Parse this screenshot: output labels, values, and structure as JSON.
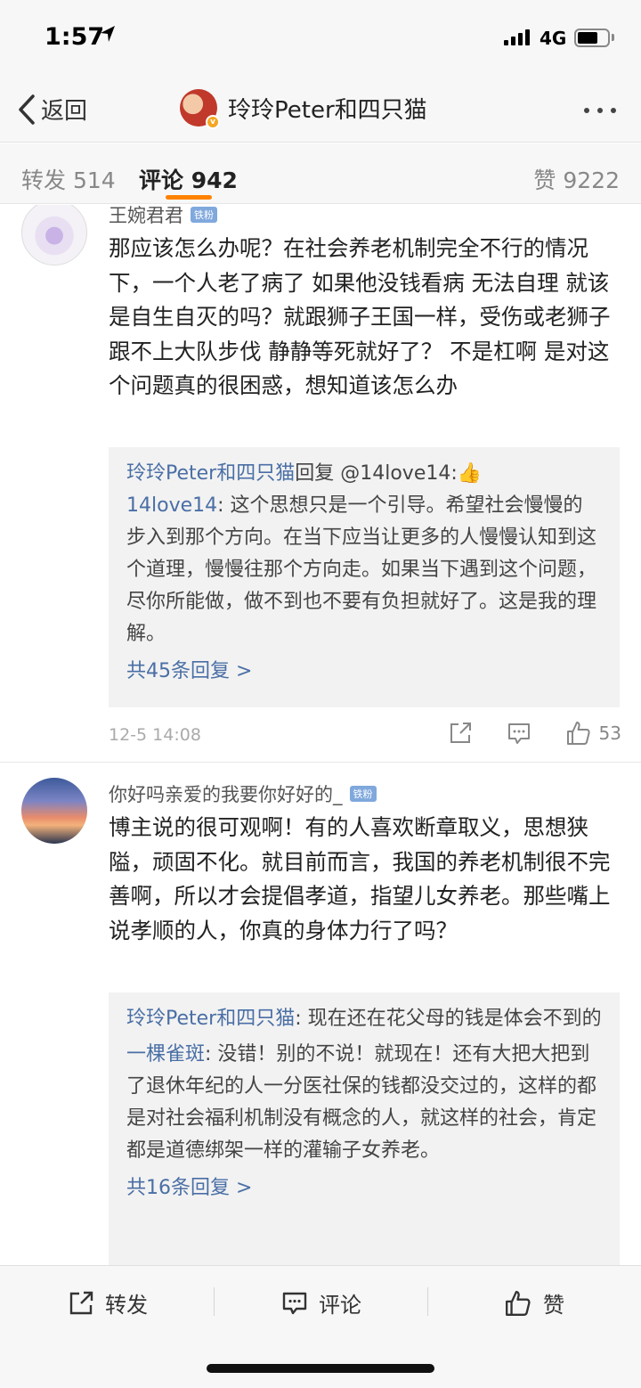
{
  "status_bar": {
    "time": "1:57",
    "network": "4G"
  },
  "nav": {
    "back_label": "返回",
    "title": "玲玲Peter和四只猫"
  },
  "tabs": {
    "repost": "转发 514",
    "comment": "评论 942",
    "like": "赞 9222"
  },
  "comments": [
    {
      "author": "王婉君君",
      "badge": "铁粉",
      "text": "那应该怎么办呢？在社会养老机制完全不行的情况下，一个人老了病了 如果他没钱看病 无法自理 就该是自生自灭的吗？就跟狮子王国一样，受伤或老狮子跟不上大队步伐 静静等死就好了？  不是杠啊  是对这个问题真的很困惑，想知道该怎么办",
      "replies": [
        {
          "name": "玲玲Peter和四只猫",
          "text": "回复 @14love14:👍"
        },
        {
          "name": "14love14",
          "text": ": 这个思想只是一个引导。希望社会慢慢的步入到那个方向。在当下应当让更多的人慢慢认知到这个道理，慢慢往那个方向走。如果当下遇到这个问题，尽你所能做，做不到也不要有负担就好了。这是我的理解。"
        }
      ],
      "more_replies": "共45条回复 >",
      "time": "12-5 14:08",
      "likes": "53"
    },
    {
      "author": "你好吗亲爱的我要你好好的_",
      "badge": "铁粉",
      "text": "博主说的很可观啊！有的人喜欢断章取义，思想狭隘，顽固不化。就目前而言，我国的养老机制很不完善啊，所以才会提倡孝道，指望儿女养老。那些嘴上说孝顺的人，你真的身体力行了吗？",
      "replies": [
        {
          "name": "玲玲Peter和四只猫",
          "text": ": 现在还在花父母的钱是体会不到的"
        },
        {
          "name": "一棵雀斑",
          "text": ": 没错！别的不说！就现在！还有大把大把到了退休年纪的人一分医社保的钱都没交过的，这样的都是对社会福利机制没有概念的人，就这样的社会，肯定都是道德绑架一样的灌输子女养老。"
        }
      ],
      "more_replies": "共16条回复 >"
    }
  ],
  "toolbar": {
    "repost": "转发",
    "comment": "评论",
    "like": "赞"
  },
  "icons": {
    "back": "chevron-left-icon",
    "more": "more-dots-icon",
    "share": "share-icon",
    "comment": "comment-icon",
    "like": "thumbs-up-icon"
  },
  "colors": {
    "accent": "#ff8200",
    "link": "#4a6fa5",
    "badge": "#7fa8dc"
  }
}
